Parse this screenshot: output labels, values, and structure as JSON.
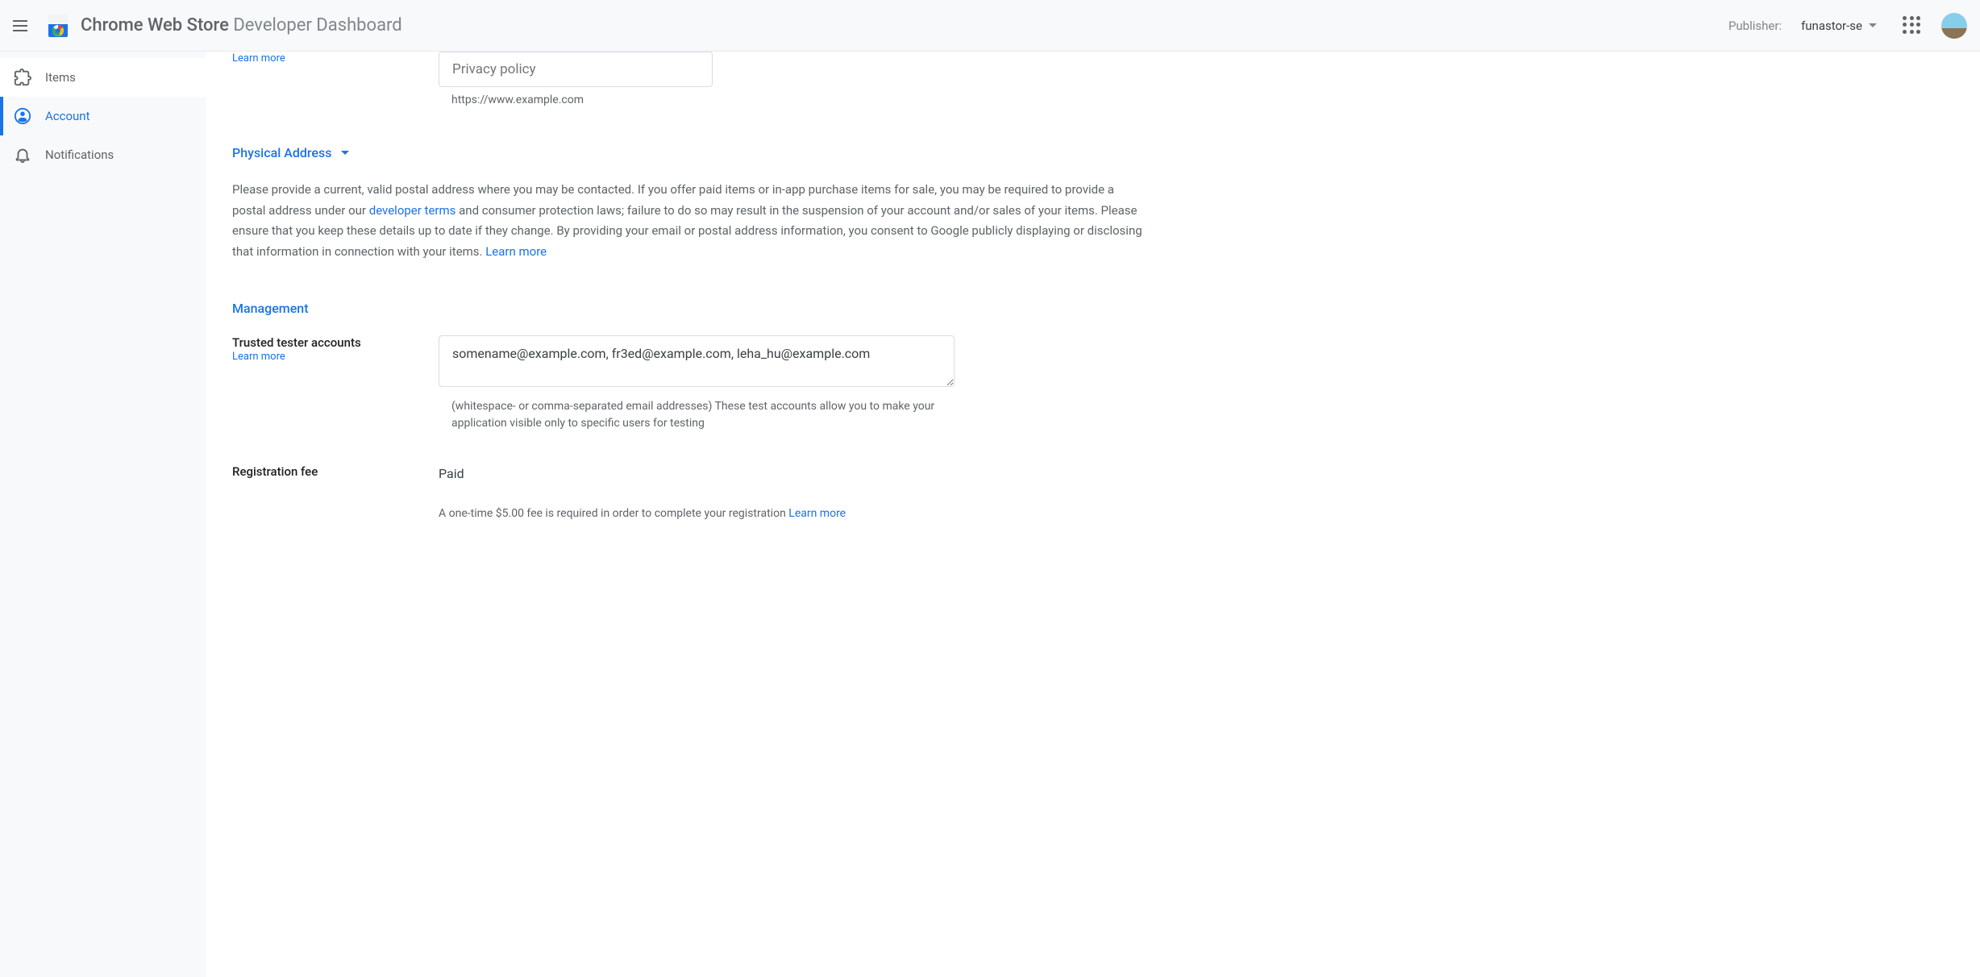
{
  "header": {
    "title_bold": "Chrome Web Store",
    "title_light": " Developer Dashboard",
    "publisher_label": "Publisher:",
    "publisher_value": "funastor-se"
  },
  "sidebar": {
    "items": [
      {
        "label": "Items"
      },
      {
        "label": "Account"
      },
      {
        "label": "Notifications"
      }
    ]
  },
  "privacy": {
    "learn_more": "Learn more",
    "placeholder": "Privacy policy",
    "helper": "https://www.example.com"
  },
  "physical_address": {
    "header": "Physical Address",
    "text_part1": "Please provide a current, valid postal address where you may be contacted. If you offer paid items or in-app purchase items for sale, you may be required to provide a postal address under our ",
    "link_terms": "developer terms",
    "text_part2": " and consumer protection laws; failure to do so may result in the suspension of your account and/or sales of your items. Please ensure that you keep these details up to date if they change. By providing your email or postal address information, you consent to Google publicly displaying or disclosing that information in connection with your items. ",
    "link_learn": "Learn more"
  },
  "management": {
    "header": "Management",
    "trusted_testers_label": "Trusted tester accounts",
    "trusted_testers_learn": "Learn more",
    "trusted_testers_value": "somename@example.com, fr3ed@example.com, leha_hu@example.com",
    "trusted_testers_helper": "(whitespace- or comma-separated email addresses) These test accounts allow you to make your application visible only to specific users for testing",
    "registration_label": "Registration fee",
    "registration_value": "Paid",
    "registration_helper": "A one-time $5.00 fee is required in order to complete your registration ",
    "registration_learn": "Learn more"
  }
}
